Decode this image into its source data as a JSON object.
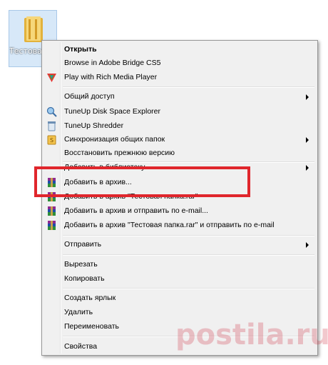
{
  "desktop": {
    "folder_label": "Тестова\nпапка"
  },
  "menu": {
    "items": [
      {
        "label": "Открыть",
        "bold": true
      },
      {
        "label": "Browse in Adobe Bridge CS5"
      },
      {
        "label": "Play with Rich Media Player",
        "icon": "rich-media-player-icon"
      },
      {
        "label": "Общий доступ",
        "submenu": true
      },
      {
        "label": "TuneUp Disk Space Explorer",
        "icon": "disk-space-explorer-icon"
      },
      {
        "label": "TuneUp Shredder",
        "icon": "shredder-icon"
      },
      {
        "label": "Синхронизация общих папок",
        "icon": "sync-folder-icon",
        "submenu": true
      },
      {
        "label": "Восстановить прежнюю версию"
      },
      {
        "label": "Добавить в библиотеку",
        "submenu": true
      },
      {
        "label": "Добавить в архив...",
        "icon": "winrar-icon"
      },
      {
        "label": "Добавить в архив \"Тестовая папка.rar\"",
        "icon": "winrar-icon"
      },
      {
        "label": "Добавить в архив и отправить по e-mail...",
        "icon": "winrar-icon"
      },
      {
        "label": "Добавить в архив \"Тестовая папка.rar\" и отправить по e-mail",
        "icon": "winrar-icon"
      },
      {
        "label": "Отправить",
        "submenu": true
      },
      {
        "label": "Вырезать"
      },
      {
        "label": "Копировать"
      },
      {
        "label": "Создать ярлык"
      },
      {
        "label": "Удалить"
      },
      {
        "label": "Переименовать"
      },
      {
        "label": "Свойства"
      }
    ]
  },
  "watermark": "postila.ru",
  "colors": {
    "highlight": "#e0262c",
    "menu_bg": "#f0f0f0",
    "watermark": "#cf2a3c"
  }
}
